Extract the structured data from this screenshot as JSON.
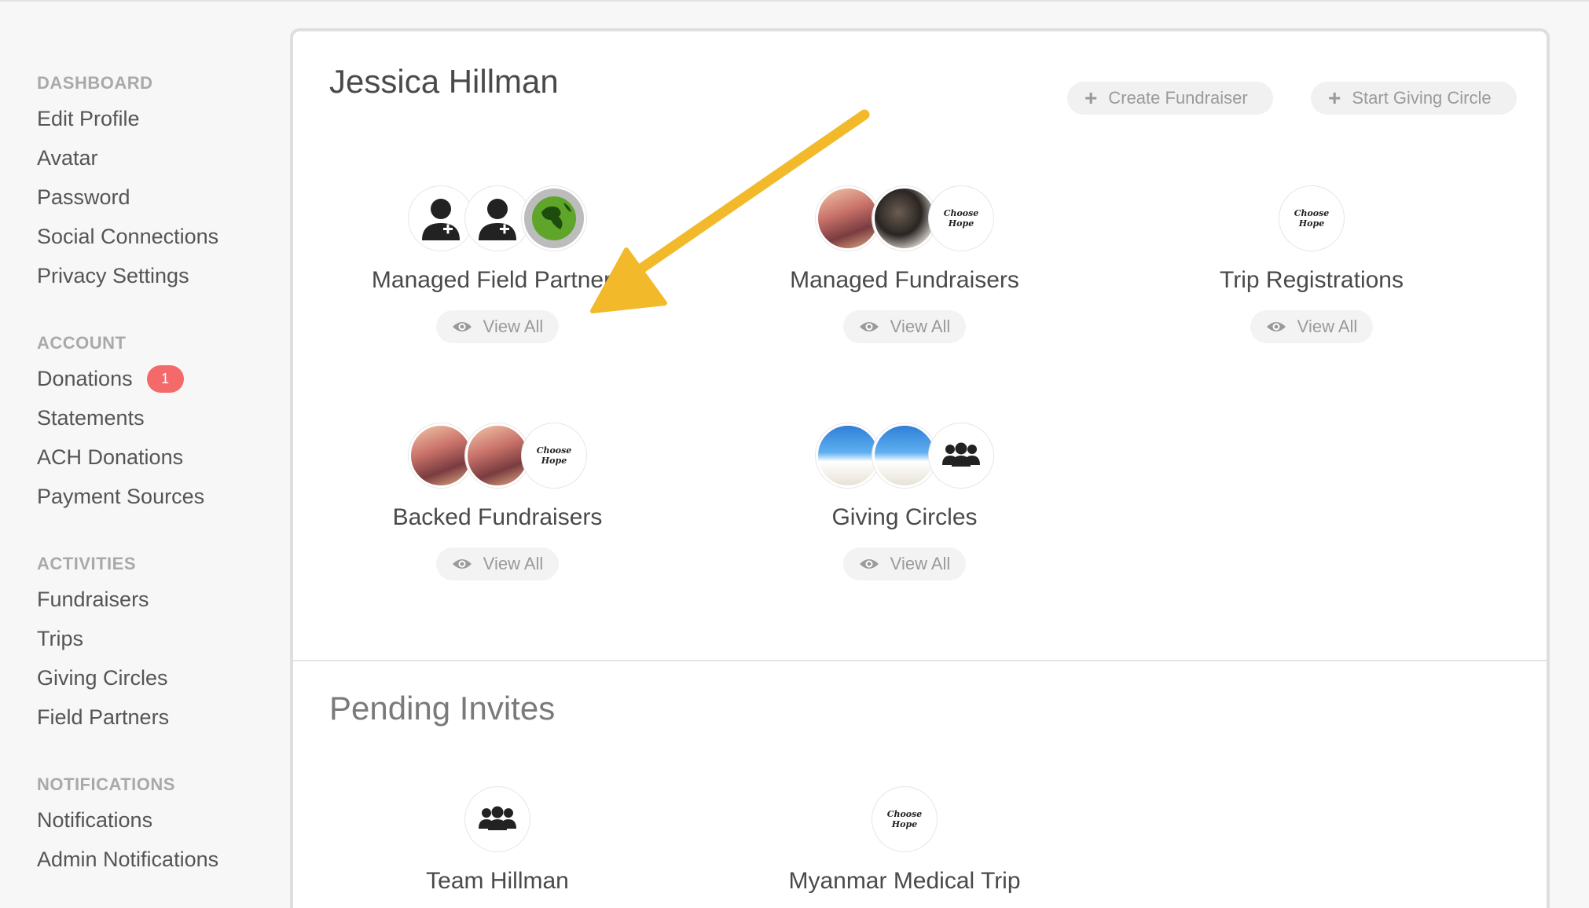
{
  "sidebar": {
    "sections": [
      {
        "title": "DASHBOARD",
        "items": [
          {
            "label": "Edit Profile"
          },
          {
            "label": "Avatar"
          },
          {
            "label": "Password"
          },
          {
            "label": "Social Connections"
          },
          {
            "label": "Privacy Settings"
          }
        ]
      },
      {
        "title": "ACCOUNT",
        "items": [
          {
            "label": "Donations",
            "badge": "1"
          },
          {
            "label": "Statements"
          },
          {
            "label": "ACH Donations"
          },
          {
            "label": "Payment Sources"
          }
        ]
      },
      {
        "title": "ACTIVITIES",
        "items": [
          {
            "label": "Fundraisers"
          },
          {
            "label": "Trips"
          },
          {
            "label": "Giving Circles"
          },
          {
            "label": "Field Partners"
          }
        ]
      },
      {
        "title": "NOTIFICATIONS",
        "items": [
          {
            "label": "Notifications"
          },
          {
            "label": "Admin Notifications"
          }
        ]
      }
    ]
  },
  "main": {
    "user_name": "Jessica Hillman",
    "create_fundraiser_label": "Create Fundraiser",
    "start_giving_circle_label": "Start Giving Circle",
    "view_all_label": "View All",
    "cards": [
      {
        "label": "Managed Field Partners"
      },
      {
        "label": "Managed Fundraisers"
      },
      {
        "label": "Trip Registrations"
      },
      {
        "label": "Backed Fundraisers"
      },
      {
        "label": "Giving Circles"
      }
    ],
    "logo_text": "Choose Hope"
  },
  "pending": {
    "title": "Pending Invites",
    "items": [
      {
        "label": "Team Hillman"
      },
      {
        "label": "Myanmar Medical Trip"
      }
    ]
  },
  "colors": {
    "badge": "#f46a6a",
    "arrow": "#f2b92b",
    "text": "#4a4a4a",
    "muted": "#9a9a9a"
  }
}
